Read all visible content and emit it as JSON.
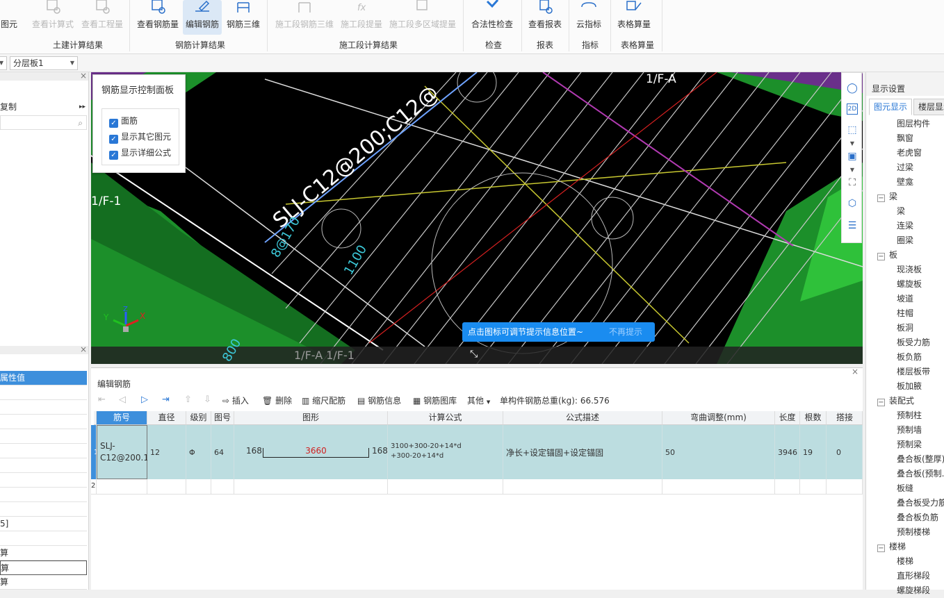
{
  "ribbon": {
    "buttons": [
      {
        "label": "图元",
        "disabled": false
      },
      {
        "label": "查看计算式",
        "disabled": true
      },
      {
        "label": "查看工程量",
        "disabled": true
      },
      {
        "label": "查看钢筋量",
        "disabled": false
      },
      {
        "label": "编辑钢筋",
        "disabled": false,
        "active": true
      },
      {
        "label": "钢筋三维",
        "disabled": false
      },
      {
        "label": "施工段钢筋三维",
        "disabled": true
      },
      {
        "label": "施工段提量",
        "disabled": true
      },
      {
        "label": "施工段多区域提量",
        "disabled": true
      },
      {
        "label": "合法性检查",
        "disabled": false
      },
      {
        "label": "查看报表",
        "disabled": false
      },
      {
        "label": "云指标",
        "disabled": false
      },
      {
        "label": "表格算量",
        "disabled": false
      }
    ],
    "groups": [
      "土建计算结果",
      "钢筋计算结果",
      "施工段计算结果",
      "检查",
      "报表",
      "指标",
      "表格算量"
    ]
  },
  "toolbar2": {
    "layer_combo": "分层板1"
  },
  "left_panel": {
    "copy_label": "复制",
    "prop_header": "属性值",
    "value_bracket": "5]",
    "calc_rows": [
      "算",
      "算",
      "算"
    ]
  },
  "viewport": {
    "labels": [
      "1/F-A",
      "1/F-1",
      "1/F-A 1/F-1"
    ],
    "rebar_text": "SLJ-C12@200;C12@",
    "dims": [
      "8@170",
      "1100",
      "800"
    ],
    "axis": {
      "x": "X",
      "y": "Y",
      "z": "Z"
    },
    "colors": {
      "slab_green": "#1c8f2a",
      "bg": "#000000",
      "purple": "#6a2f8a",
      "highlight": "#1a8cf0"
    }
  },
  "control_panel": {
    "title": "钢筋显示控制面板",
    "options": [
      "面筋",
      "显示其它图元",
      "显示详细公式"
    ]
  },
  "tip": {
    "message": "点击图标可调节提示信息位置~",
    "dismiss": "不再提示"
  },
  "right_panel": {
    "title": "显示设置",
    "tabs": [
      "图元显示",
      "楼层显示"
    ],
    "tree": [
      {
        "label": "图层构件",
        "level": 0,
        "group": false
      },
      {
        "label": "飘窗",
        "level": 1,
        "group": false
      },
      {
        "label": "老虎窗",
        "level": 1,
        "group": false
      },
      {
        "label": "过梁",
        "level": 1,
        "group": false
      },
      {
        "label": "壁龛",
        "level": 1,
        "group": false
      },
      {
        "label": "梁",
        "level": 0,
        "group": true
      },
      {
        "label": "梁",
        "level": 1,
        "group": false
      },
      {
        "label": "连梁",
        "level": 1,
        "group": false
      },
      {
        "label": "圈梁",
        "level": 1,
        "group": false
      },
      {
        "label": "板",
        "level": 0,
        "group": true
      },
      {
        "label": "现浇板",
        "level": 1,
        "group": false
      },
      {
        "label": "螺旋板",
        "level": 1,
        "group": false
      },
      {
        "label": "坡道",
        "level": 1,
        "group": false
      },
      {
        "label": "柱帽",
        "level": 1,
        "group": false
      },
      {
        "label": "板洞",
        "level": 1,
        "group": false
      },
      {
        "label": "板受力筋",
        "level": 1,
        "group": false
      },
      {
        "label": "板负筋",
        "level": 1,
        "group": false
      },
      {
        "label": "楼层板带",
        "level": 1,
        "group": false
      },
      {
        "label": "板加腋",
        "level": 1,
        "group": false
      },
      {
        "label": "装配式",
        "level": 0,
        "group": true
      },
      {
        "label": "预制柱",
        "level": 1,
        "group": false
      },
      {
        "label": "预制墙",
        "level": 1,
        "group": false
      },
      {
        "label": "预制梁",
        "level": 1,
        "group": false
      },
      {
        "label": "叠合板(整厚)",
        "level": 1,
        "group": false
      },
      {
        "label": "叠合板(预制...",
        "level": 1,
        "group": false
      },
      {
        "label": "板缝",
        "level": 1,
        "group": false
      },
      {
        "label": "叠合板受力筋",
        "level": 1,
        "group": false
      },
      {
        "label": "叠合板负筋",
        "level": 1,
        "group": false
      },
      {
        "label": "预制楼梯",
        "level": 1,
        "group": false
      },
      {
        "label": "楼梯",
        "level": 0,
        "group": true
      },
      {
        "label": "楼梯",
        "level": 1,
        "group": false
      },
      {
        "label": "直形梯段",
        "level": 1,
        "group": false
      },
      {
        "label": "螺旋梯段",
        "level": 1,
        "group": false
      }
    ]
  },
  "edit_panel": {
    "title": "编辑钢筋",
    "toolbar": {
      "insert": "插入",
      "delete": "删除",
      "scale": "缩尺配筋",
      "info": "钢筋信息",
      "library": "钢筋图库",
      "other": "其他",
      "total_label": "单构件钢筋总重(kg):",
      "total_value": "66.576"
    },
    "columns": [
      "筋号",
      "直径(mm)",
      "级别",
      "图号",
      "图形",
      "计算公式",
      "公式描述",
      "弯曲调整(mm)",
      "长度",
      "根数",
      "搭接"
    ],
    "rows": [
      {
        "index": "1",
        "bar_no": "SLJ-C12@200.1",
        "diameter": "12",
        "grade": "Φ",
        "shape_no": "64",
        "shape": {
          "left": "168",
          "mid": "3660",
          "right": "168"
        },
        "formula_line1": "3100+300-20+14*d",
        "formula_line2": "+300-20+14*d",
        "description": "净长+设定锚固+设定锚固",
        "bend_adjust": "50",
        "length": "3946",
        "count": "19",
        "lap": "0"
      }
    ],
    "empty_row_index": "2"
  }
}
